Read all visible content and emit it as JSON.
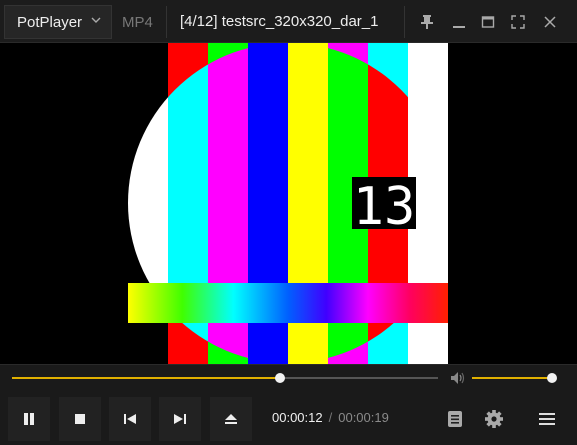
{
  "app": {
    "name": "PotPlayer",
    "format": "MP4",
    "title": "[4/12] testsrc_320x320_dar_1"
  },
  "video": {
    "frame_counter": "13"
  },
  "playback": {
    "current_time": "00:00:12",
    "separator": "/",
    "duration": "00:00:19",
    "progress_fraction": 0.63,
    "volume_fraction": 0.97
  },
  "colors": {
    "accent": "#e0b000",
    "titlebar_bg": "#1c1c1c",
    "controls_bg": "#1a1a1a"
  },
  "icons": {
    "titlebar": [
      "chevron-down-icon",
      "pin-icon",
      "minimize-icon",
      "maximize-icon",
      "fullscreen-icon",
      "close-icon"
    ],
    "controls": [
      "pause-icon",
      "stop-icon",
      "previous-icon",
      "next-icon",
      "eject-icon",
      "playlist-icon",
      "gear-icon",
      "menu-icon",
      "volume-icon"
    ]
  }
}
